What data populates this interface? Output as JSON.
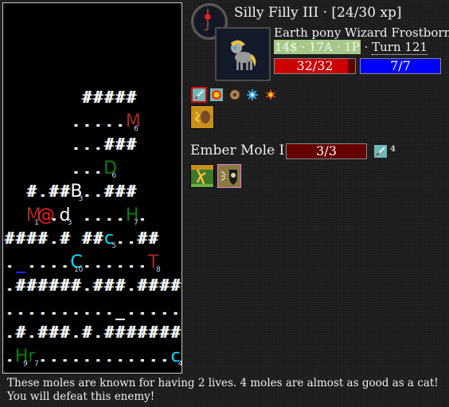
{
  "map": {
    "rows": [
      {
        "row": 4,
        "cells": [
          {
            "c": 7,
            "ch": "#"
          },
          {
            "c": 8,
            "ch": "#"
          },
          {
            "c": 9,
            "ch": "#"
          },
          {
            "c": 10,
            "ch": "#"
          },
          {
            "c": 11,
            "ch": "#"
          }
        ]
      },
      {
        "row": 5,
        "cells": [
          {
            "c": 6,
            "ch": "."
          },
          {
            "c": 7,
            "ch": "."
          },
          {
            "c": 8,
            "ch": "."
          },
          {
            "c": 9,
            "ch": "."
          },
          {
            "c": 10,
            "ch": "."
          },
          {
            "c": 11,
            "ch": "M",
            "color": "#a52a2a",
            "sub": "6",
            "mon": true
          }
        ]
      },
      {
        "row": 6,
        "cells": [
          {
            "c": 6,
            "ch": "."
          },
          {
            "c": 7,
            "ch": "."
          },
          {
            "c": 8,
            "ch": "."
          },
          {
            "c": 9,
            "ch": "#"
          },
          {
            "c": 10,
            "ch": "#"
          },
          {
            "c": 11,
            "ch": "#"
          }
        ]
      },
      {
        "row": 7,
        "cells": [
          {
            "c": 6,
            "ch": "."
          },
          {
            "c": 7,
            "ch": "."
          },
          {
            "c": 8,
            "ch": "."
          },
          {
            "c": 9,
            "ch": "D",
            "color": "#0a7a0a",
            "sub": "6",
            "mon": true
          }
        ]
      },
      {
        "row": 8,
        "cells": [
          {
            "c": 2,
            "ch": "#"
          },
          {
            "c": 3,
            "ch": "."
          },
          {
            "c": 4,
            "ch": "#"
          },
          {
            "c": 5,
            "ch": "#"
          },
          {
            "c": 6,
            "ch": "B",
            "color": "#ffffff",
            "sub": "3",
            "mon": true
          },
          {
            "c": 7,
            "ch": "."
          },
          {
            "c": 8,
            "ch": "."
          },
          {
            "c": 9,
            "ch": "#"
          },
          {
            "c": 10,
            "ch": "#"
          },
          {
            "c": 11,
            "ch": "#"
          }
        ]
      },
      {
        "row": 9,
        "cells": [
          {
            "c": 2,
            "ch": "M",
            "color": "#a52a2a",
            "sub": "1",
            "mon": true
          },
          {
            "c": 3,
            "ch": "@",
            "color": "#ff1a1a",
            "mon": true
          },
          {
            "c": 4,
            "ch": "."
          },
          {
            "c": 5,
            "ch": "d",
            "color": "#ffffff",
            "sub": "3",
            "mon": true
          },
          {
            "c": 7,
            "ch": "."
          },
          {
            "c": 8,
            "ch": "."
          },
          {
            "c": 9,
            "ch": "."
          },
          {
            "c": 10,
            "ch": "."
          },
          {
            "c": 11,
            "ch": "H",
            "color": "#0a7a0a",
            "sub": "7",
            "mon": true
          },
          {
            "c": 12,
            "ch": "."
          }
        ]
      },
      {
        "row": 10,
        "cells": [
          {
            "c": 0,
            "ch": "#"
          },
          {
            "c": 1,
            "ch": "#"
          },
          {
            "c": 2,
            "ch": "#"
          },
          {
            "c": 3,
            "ch": "#"
          },
          {
            "c": 4,
            "ch": "."
          },
          {
            "c": 5,
            "ch": "#"
          },
          {
            "c": 7,
            "ch": "#"
          },
          {
            "c": 8,
            "ch": "#"
          },
          {
            "c": 9,
            "ch": "c",
            "color": "#00e5ff",
            "sub": "5",
            "mon": true
          },
          {
            "c": 10,
            "ch": "."
          },
          {
            "c": 11,
            "ch": "."
          },
          {
            "c": 12,
            "ch": "#"
          },
          {
            "c": 13,
            "ch": "#"
          }
        ]
      },
      {
        "row": 11,
        "cells": [
          {
            "c": 0,
            "ch": "."
          },
          {
            "c": 1,
            "ch": "_",
            "under": "#2020ff"
          },
          {
            "c": 2,
            "ch": "."
          },
          {
            "c": 3,
            "ch": "."
          },
          {
            "c": 4,
            "ch": "."
          },
          {
            "c": 5,
            "ch": "."
          },
          {
            "c": 6,
            "ch": "C",
            "color": "#00e5ff",
            "sub": "10",
            "mon": true
          },
          {
            "c": 7,
            "ch": "."
          },
          {
            "c": 8,
            "ch": "."
          },
          {
            "c": 9,
            "ch": "."
          },
          {
            "c": 10,
            "ch": "."
          },
          {
            "c": 11,
            "ch": "."
          },
          {
            "c": 12,
            "ch": "."
          },
          {
            "c": 13,
            "ch": "T",
            "color": "#a52a2a",
            "sub": "8",
            "mon": true
          }
        ]
      },
      {
        "row": 12,
        "cells": [
          {
            "c": 0,
            "ch": "."
          },
          {
            "c": 1,
            "ch": "#"
          },
          {
            "c": 2,
            "ch": "#"
          },
          {
            "c": 3,
            "ch": "#"
          },
          {
            "c": 4,
            "ch": "#"
          },
          {
            "c": 5,
            "ch": "#"
          },
          {
            "c": 6,
            "ch": "#"
          },
          {
            "c": 7,
            "ch": "."
          },
          {
            "c": 8,
            "ch": "#"
          },
          {
            "c": 9,
            "ch": "#"
          },
          {
            "c": 10,
            "ch": "#"
          },
          {
            "c": 11,
            "ch": "."
          },
          {
            "c": 12,
            "ch": "#"
          },
          {
            "c": 13,
            "ch": "#"
          },
          {
            "c": 14,
            "ch": "#"
          },
          {
            "c": 15,
            "ch": "#"
          }
        ]
      },
      {
        "row": 13,
        "cells": [
          {
            "c": 0,
            "ch": "."
          },
          {
            "c": 1,
            "ch": "."
          },
          {
            "c": 2,
            "ch": "."
          },
          {
            "c": 3,
            "ch": "."
          },
          {
            "c": 4,
            "ch": "."
          },
          {
            "c": 5,
            "ch": "."
          },
          {
            "c": 6,
            "ch": "."
          },
          {
            "c": 7,
            "ch": "."
          },
          {
            "c": 8,
            "ch": "."
          },
          {
            "c": 9,
            "ch": "."
          },
          {
            "c": 10,
            "ch": "_",
            "under": "#ffffff"
          },
          {
            "c": 11,
            "ch": "."
          },
          {
            "c": 12,
            "ch": "."
          },
          {
            "c": 13,
            "ch": "."
          },
          {
            "c": 14,
            "ch": "."
          },
          {
            "c": 15,
            "ch": "."
          }
        ]
      },
      {
        "row": 14,
        "cells": [
          {
            "c": 0,
            "ch": "."
          },
          {
            "c": 1,
            "ch": "#"
          },
          {
            "c": 2,
            "ch": "."
          },
          {
            "c": 3,
            "ch": "#"
          },
          {
            "c": 4,
            "ch": "#"
          },
          {
            "c": 5,
            "ch": "#"
          },
          {
            "c": 6,
            "ch": "."
          },
          {
            "c": 7,
            "ch": "#"
          },
          {
            "c": 8,
            "ch": "."
          },
          {
            "c": 9,
            "ch": "#"
          },
          {
            "c": 10,
            "ch": "#"
          },
          {
            "c": 11,
            "ch": "#"
          },
          {
            "c": 12,
            "ch": "#"
          },
          {
            "c": 13,
            "ch": "#"
          },
          {
            "c": 14,
            "ch": "#"
          },
          {
            "c": 15,
            "ch": "#"
          }
        ]
      },
      {
        "row": 15,
        "cells": [
          {
            "c": 0,
            "ch": "."
          },
          {
            "c": 1,
            "ch": "H",
            "color": "#0a7a0a",
            "sub": "9",
            "mon": true
          },
          {
            "c": 2,
            "ch": "r",
            "color": "#0a7a0a",
            "sub": "7",
            "mon": true
          },
          {
            "c": 3,
            "ch": "."
          },
          {
            "c": 4,
            "ch": "."
          },
          {
            "c": 5,
            "ch": "."
          },
          {
            "c": 6,
            "ch": "."
          },
          {
            "c": 7,
            "ch": "."
          },
          {
            "c": 8,
            "ch": "."
          },
          {
            "c": 9,
            "ch": "."
          },
          {
            "c": 10,
            "ch": "."
          },
          {
            "c": 11,
            "ch": "."
          },
          {
            "c": 12,
            "ch": "."
          },
          {
            "c": 13,
            "ch": "."
          },
          {
            "c": 14,
            "ch": "."
          },
          {
            "c": 15,
            "ch": "c",
            "color": "#00e5ff",
            "sub": "4",
            "mon": true
          }
        ]
      }
    ]
  },
  "player": {
    "name_line": "Silly Filly III · [24/30 xp]",
    "description": "Earth pony Wizard Frostborn",
    "resources": "14$ · 17A · 1P",
    "turn_sep": " · ",
    "turn": "Turn 121",
    "hp": {
      "text": "32/32",
      "fraction": 0.91
    },
    "mp": {
      "text": "7/7"
    },
    "amulet_icon": "amulet-icon",
    "portrait_icon": "pony-portrait"
  },
  "abilities": [
    {
      "name": "sword-skill-icon",
      "selected": true
    },
    {
      "name": "fireball-skill-icon"
    },
    {
      "name": "shield-orb-icon"
    },
    {
      "name": "frost-spark-icon"
    },
    {
      "name": "fire-burst-icon"
    }
  ],
  "status_tiles": [
    {
      "name": "earth-strength-status-icon"
    }
  ],
  "enemy": {
    "name": "Ember Mole I",
    "hp": {
      "text": "3/3"
    },
    "attack_icon": "sword-icon",
    "attack": "4",
    "tiles": [
      {
        "name": "forest-terrain-icon"
      },
      {
        "name": "skull-shield-status-icon"
      }
    ]
  },
  "message": {
    "line1": "These moles are known for having 2 lives. 4 moles are almost as good as a cat!",
    "line2": "You will defeat this enemy!"
  }
}
